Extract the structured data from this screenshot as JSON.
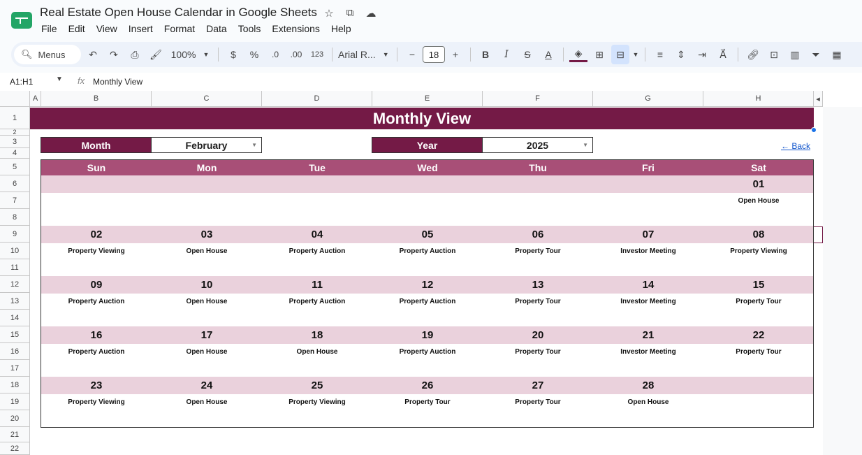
{
  "doc": {
    "title": "Real Estate Open House Calendar in Google Sheets",
    "menu": [
      "File",
      "Edit",
      "View",
      "Insert",
      "Format",
      "Data",
      "Tools",
      "Extensions",
      "Help"
    ]
  },
  "toolbar": {
    "menus_label": "Menus",
    "zoom": "100%",
    "currency": "$",
    "percent": "%",
    "dec_decrease": ".0",
    "dec_increase": ".00",
    "number_format": "123",
    "font": "Arial R...",
    "font_size": "18"
  },
  "formula_bar": {
    "name_box": "A1:H1",
    "fx": "fx",
    "content": "Monthly View"
  },
  "grid": {
    "columns": [
      "A",
      "B",
      "C",
      "D",
      "E",
      "F",
      "G",
      "H"
    ],
    "rows": [
      "1",
      "2",
      "3",
      "4",
      "5",
      "6",
      "7",
      "8",
      "9",
      "10",
      "11",
      "12",
      "13",
      "14",
      "15",
      "16",
      "17",
      "18",
      "19",
      "20",
      "21",
      "22"
    ]
  },
  "sheet": {
    "banner": "Monthly View",
    "month_label": "Month",
    "month_value": "February",
    "year_label": "Year",
    "year_value": "2025",
    "back_link": "← Back"
  },
  "calendar": {
    "days": [
      "Sun",
      "Mon",
      "Tue",
      "Wed",
      "Thu",
      "Fri",
      "Sat"
    ],
    "weeks": [
      [
        {
          "d": "",
          "e": ""
        },
        {
          "d": "",
          "e": ""
        },
        {
          "d": "",
          "e": ""
        },
        {
          "d": "",
          "e": ""
        },
        {
          "d": "",
          "e": ""
        },
        {
          "d": "",
          "e": ""
        },
        {
          "d": "01",
          "e": "Open House"
        }
      ],
      [
        {
          "d": "02",
          "e": "Property Viewing"
        },
        {
          "d": "03",
          "e": "Open House"
        },
        {
          "d": "04",
          "e": "Property Auction"
        },
        {
          "d": "05",
          "e": "Property Auction"
        },
        {
          "d": "06",
          "e": "Property Tour"
        },
        {
          "d": "07",
          "e": "Investor Meeting"
        },
        {
          "d": "08",
          "e": "Property Viewing"
        }
      ],
      [
        {
          "d": "09",
          "e": "Property Auction"
        },
        {
          "d": "10",
          "e": "Open House"
        },
        {
          "d": "11",
          "e": "Property Auction"
        },
        {
          "d": "12",
          "e": "Property Auction"
        },
        {
          "d": "13",
          "e": "Property Tour"
        },
        {
          "d": "14",
          "e": "Investor Meeting"
        },
        {
          "d": "15",
          "e": "Property Tour"
        }
      ],
      [
        {
          "d": "16",
          "e": "Property Auction"
        },
        {
          "d": "17",
          "e": "Open House"
        },
        {
          "d": "18",
          "e": "Open House"
        },
        {
          "d": "19",
          "e": "Property Auction"
        },
        {
          "d": "20",
          "e": "Property Tour"
        },
        {
          "d": "21",
          "e": "Investor Meeting"
        },
        {
          "d": "22",
          "e": "Property Tour"
        }
      ],
      [
        {
          "d": "23",
          "e": "Property Viewing"
        },
        {
          "d": "24",
          "e": "Open House"
        },
        {
          "d": "25",
          "e": "Property Viewing"
        },
        {
          "d": "26",
          "e": "Property Tour"
        },
        {
          "d": "27",
          "e": "Property Tour"
        },
        {
          "d": "28",
          "e": "Open House"
        },
        {
          "d": "",
          "e": ""
        }
      ]
    ]
  },
  "colors": {
    "banner": "#741a46",
    "day_header": "#a84f77",
    "date_band": "#ead1dc",
    "accent_blue": "#1a73e8"
  }
}
